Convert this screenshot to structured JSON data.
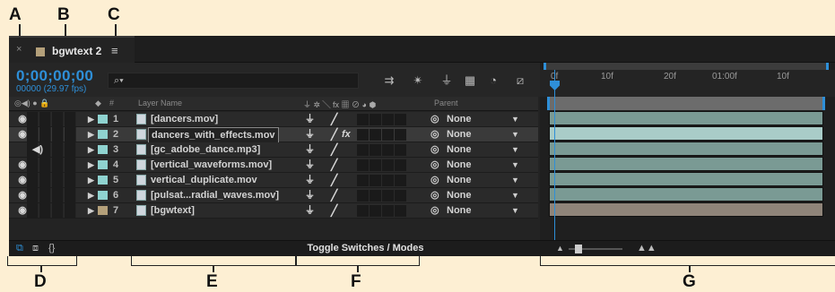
{
  "callouts": {
    "A": "A",
    "B": "B",
    "C": "C",
    "D": "D",
    "E": "E",
    "F": "F",
    "G": "G"
  },
  "tab": {
    "close": "×",
    "title": "bgwtext 2",
    "menu": "≡"
  },
  "current_time": "0;00;00;00",
  "frame_info": "00000 (29.97 fps)",
  "search_placeholder": "⌕▾",
  "columns": {
    "label_tag": "#",
    "layer_name": "Layer Name",
    "parent": "Parent",
    "switch_icons": "⏚ ✲ ╲ fx ▦ ⊘ ◕ ⬢"
  },
  "layers": [
    {
      "number": "1",
      "name": "[dancers.mov]",
      "parent": "None",
      "label_color": "#8fd3d0",
      "audio": false,
      "video": true,
      "fx": false,
      "selected": false,
      "boxed": false
    },
    {
      "number": "2",
      "name": "dancers_with_effects.mov",
      "parent": "None",
      "label_color": "#8fd3d0",
      "audio": false,
      "video": true,
      "fx": true,
      "selected": true,
      "boxed": true
    },
    {
      "number": "3",
      "name": "[gc_adobe_dance.mp3]",
      "parent": "None",
      "label_color": "#8fd3d0",
      "audio": true,
      "video": false,
      "fx": false,
      "selected": false,
      "boxed": false
    },
    {
      "number": "4",
      "name": "[vertical_waveforms.mov]",
      "parent": "None",
      "label_color": "#8fd3d0",
      "audio": false,
      "video": true,
      "fx": false,
      "selected": false,
      "boxed": false
    },
    {
      "number": "5",
      "name": "vertical_duplicate.mov",
      "parent": "None",
      "label_color": "#8fd3d0",
      "audio": false,
      "video": true,
      "fx": false,
      "selected": false,
      "boxed": false
    },
    {
      "number": "6",
      "name": "[pulsat...radial_waves.mov]",
      "parent": "None",
      "label_color": "#8fd3d0",
      "audio": false,
      "video": true,
      "fx": false,
      "selected": false,
      "boxed": false
    },
    {
      "number": "7",
      "name": "[bgwtext]",
      "parent": "None",
      "label_color": "#b4a07a",
      "audio": false,
      "video": true,
      "fx": false,
      "selected": false,
      "boxed": false
    }
  ],
  "ruler_ticks": [
    "0f",
    "10f",
    "20f",
    "01:00f",
    "10f"
  ],
  "toggle_label": "Toggle Switches / Modes",
  "colors": {
    "accent": "#2e8fd8",
    "bar_teal": "#7a9a94",
    "bar_selected": "#a9ccc8",
    "bar_tan": "#8f8479",
    "background": "#fdefd3"
  }
}
